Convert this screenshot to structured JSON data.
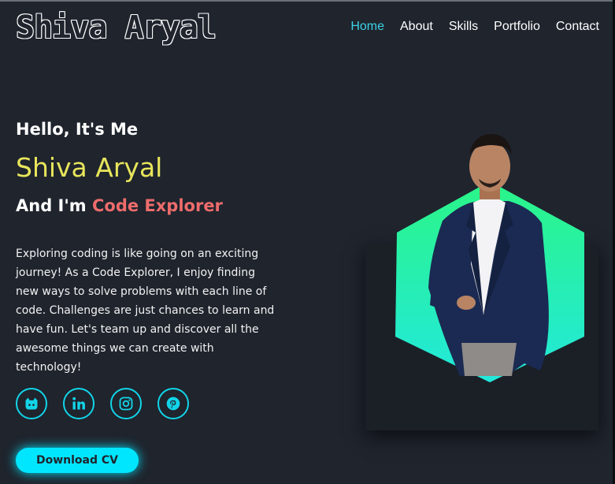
{
  "header": {
    "logo": "Shiva Aryal",
    "nav": [
      {
        "label": "Home",
        "active": true
      },
      {
        "label": "About",
        "active": false
      },
      {
        "label": "Skills",
        "active": false
      },
      {
        "label": "Portfolio",
        "active": false
      },
      {
        "label": "Contact",
        "active": false
      }
    ]
  },
  "hero": {
    "greeting": "Hello, It's Me",
    "name": "Shiva Aryal",
    "role_prefix": "And I'm ",
    "role_highlight": "Code Explorer",
    "bio": "Exploring coding is like going on an exciting journey! As a Code Explorer, I enjoy finding new ways to solve problems with each line of code. Challenges are just chances to learn and have fun. Let's team up and discover all the awesome things we can create with technology!"
  },
  "social": [
    {
      "icon": "github-icon"
    },
    {
      "icon": "linkedin-icon"
    },
    {
      "icon": "instagram-icon"
    },
    {
      "icon": "pinterest-icon"
    }
  ],
  "cta": {
    "download_label": "Download CV"
  },
  "colors": {
    "background": "#1f242d",
    "accent": "#00e6ff",
    "name": "#e8e55b",
    "role_highlight": "#ee6c6c"
  }
}
